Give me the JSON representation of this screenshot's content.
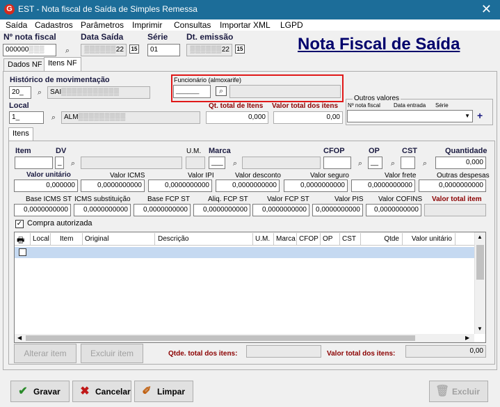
{
  "window": {
    "title": "EST - Nota fiscal de Saída de Simples Remessa",
    "app_icon_letter": "G",
    "close_glyph": "✕"
  },
  "menu": [
    "Saída",
    "Cadastros",
    "Parâmetros",
    "Imprimir",
    "Consultas",
    "Importar XML",
    "LGPD"
  ],
  "header": {
    "nota_fiscal_label": "Nº nota fiscal",
    "nota_fiscal_value": "000000",
    "data_saida_label": "Data Saída",
    "data_saida_value": "22",
    "serie_label": "Série",
    "serie_value": "01",
    "dt_emissao_label": "Dt. emissão",
    "dt_emissao_value": "22",
    "cal_glyph": "15",
    "page_title": "Nota Fiscal de Saída"
  },
  "tabs": [
    "Dados NF",
    "Itens NF"
  ],
  "itens_nf": {
    "historico_label": "Histórico de movimentação",
    "historico_code": "20",
    "historico_desc": "SAI",
    "funcionario_label": "Funcionário (almoxarife)",
    "funcionario_value": "",
    "local_label": "Local",
    "local_code": "1",
    "local_desc": "ALM",
    "qt_total_label": "Qt. total de Itens",
    "qt_total_value": "0,000",
    "valor_total_label": "Valor total dos itens",
    "valor_total_value": "0,00",
    "outros_valores_label": "Outros valores",
    "outros_cols": [
      "Nº nota fiscal",
      "Data entrada",
      "Série"
    ],
    "plus_glyph": "+"
  },
  "itens_tab": "Itens",
  "item_fields": {
    "item_label": "Item",
    "dv_label": "DV",
    "um_label": "U.M.",
    "marca_label": "Marca",
    "cfop_label": "CFOP",
    "op_label": "OP",
    "cst_label": "CST",
    "quantidade_label": "Quantidade",
    "quantidade_value": "0,000",
    "row2": [
      {
        "label": "Valor unitário",
        "value": "0,000000"
      },
      {
        "label": "Valor ICMS",
        "value": "0,0000000000"
      },
      {
        "label": "Valor IPI",
        "value": "0,0000000000"
      },
      {
        "label": "Valor desconto",
        "value": "0,0000000000"
      },
      {
        "label": "Valor seguro",
        "value": "0,0000000000"
      },
      {
        "label": "Valor frete",
        "value": "0,0000000000"
      },
      {
        "label": "Outras despesas",
        "value": "0,0000000000"
      }
    ],
    "row3": [
      {
        "label": "Base ICMS ST",
        "value": "0,0000000000"
      },
      {
        "label": "ICMS substituição",
        "value": "0,0000000000"
      },
      {
        "label": "Base FCP ST",
        "value": "0,0000000000"
      },
      {
        "label": "Aliq. FCP ST",
        "value": "0,0000000000"
      },
      {
        "label": "Valor FCP ST",
        "value": "0,0000000000"
      },
      {
        "label": "Valor PIS",
        "value": "0,0000000000"
      },
      {
        "label": "Valor COFINS",
        "value": "0,0000000000"
      },
      {
        "label": "Valor total item",
        "value": ""
      }
    ],
    "compra_autorizada_label": "Compra autorizada",
    "compra_autorizada_checked": true
  },
  "grid": {
    "columns": [
      "Local",
      "Item",
      "Original",
      "Descrição",
      "U.M.",
      "Marca",
      "CFOP",
      "OP",
      "CST",
      "Qtde",
      "Valor unitário"
    ]
  },
  "grid_buttons": {
    "alterar": "Alterar item",
    "excluir": "Excluir item"
  },
  "totals": {
    "qtde_label": "Qtde. total dos itens:",
    "qtde_value": "",
    "valor_label": "Valor total dos itens:",
    "valor_value": "0,00"
  },
  "footer": {
    "gravar": "Gravar",
    "cancelar": "Cancelar",
    "limpar": "Limpar",
    "excluir": "Excluir"
  },
  "colors": {
    "titlebar": "#1c6d99",
    "title_accent": "#00006b",
    "highlight": "#e01818",
    "grid_selected_row": "#c5d9f1"
  }
}
